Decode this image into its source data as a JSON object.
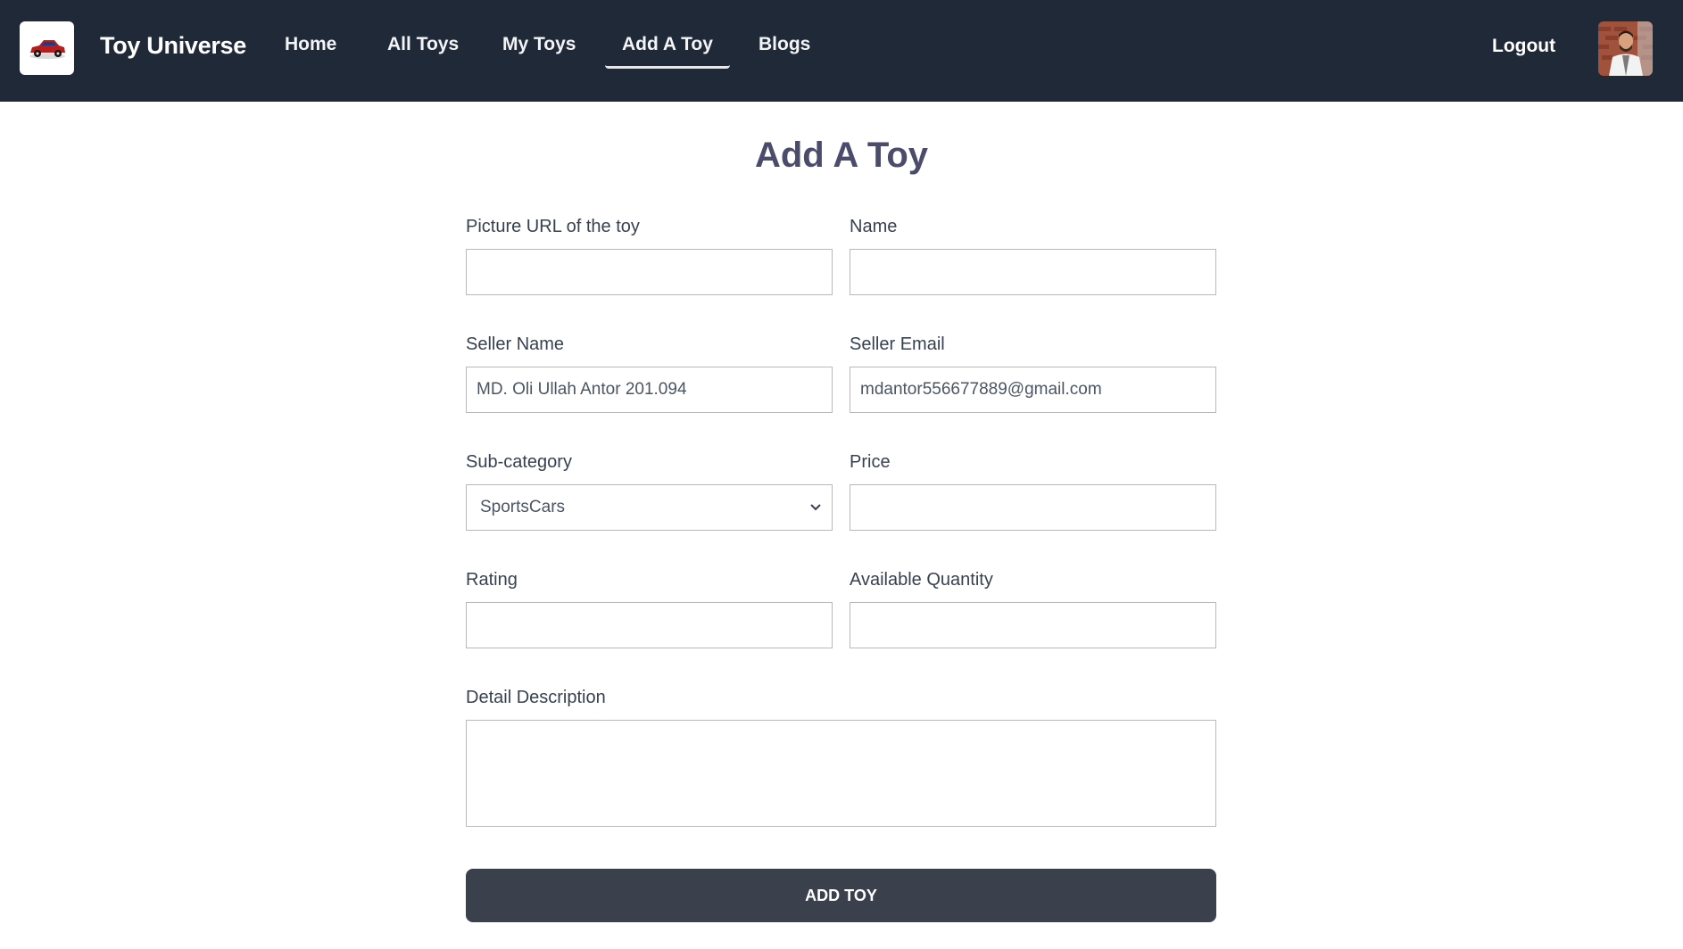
{
  "brand": {
    "name": "Toy Universe",
    "logo_icon": "car-logo-icon"
  },
  "nav": {
    "items": [
      {
        "label": "Home"
      },
      {
        "label": "All Toys"
      },
      {
        "label": "My Toys"
      },
      {
        "label": "Add A Toy",
        "active": true
      },
      {
        "label": "Blogs"
      }
    ],
    "logout_label": "Logout",
    "avatar_icon": "user-avatar"
  },
  "page": {
    "title": "Add A Toy"
  },
  "form": {
    "picture_url": {
      "label": "Picture URL of the toy",
      "value": ""
    },
    "name": {
      "label": "Name",
      "value": ""
    },
    "seller_name": {
      "label": "Seller Name",
      "value": "MD. Oli Ullah Antor 201.094"
    },
    "seller_email": {
      "label": "Seller Email",
      "value": "mdantor556677889@gmail.com"
    },
    "sub_category": {
      "label": "Sub-category",
      "value": "SportsCars"
    },
    "price": {
      "label": "Price",
      "value": ""
    },
    "rating": {
      "label": "Rating",
      "value": ""
    },
    "quantity": {
      "label": "Available Quantity",
      "value": ""
    },
    "description": {
      "label": "Detail Description",
      "value": ""
    },
    "submit_label": "ADD TOY"
  },
  "colors": {
    "navbar_bg": "#1f2937",
    "title": "#4b4b6b",
    "button_bg": "#3b404d"
  }
}
